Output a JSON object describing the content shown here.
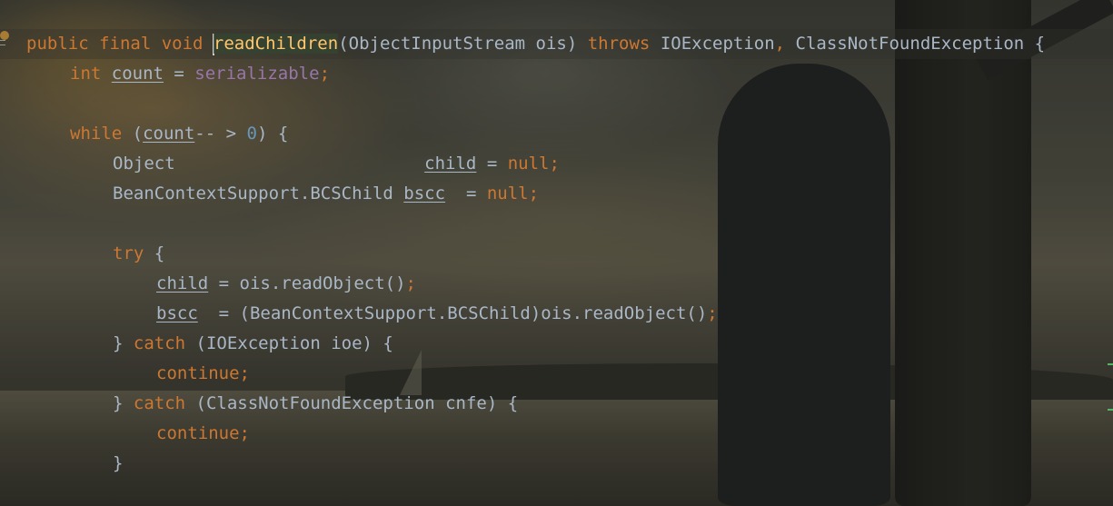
{
  "editor": {
    "colors": {
      "keyword": "#cc7832",
      "method_decl": "#ffc66d",
      "field": "#9876aa",
      "number": "#6897bb",
      "text": "#a9b7c6",
      "gutter_bulb": "#e9a53b"
    },
    "icons": {
      "gutter": "lightbulb-icon"
    },
    "lines": {
      "l1": {
        "kw1": "public final void ",
        "method": "readChildren",
        "args": "(ObjectInputStream ois) ",
        "kw2": "throws ",
        "ex1": "IOException",
        "comma": ", ",
        "ex2": "ClassNotFoundException {"
      },
      "l2": {
        "kw": "int ",
        "var": "count",
        "eq": " = ",
        "field": "serializable",
        "semi": ";"
      },
      "l4": {
        "kw": "while ",
        "open": "(",
        "var": "count",
        "op": "-- > ",
        "num": "0",
        "close": ") {"
      },
      "l5": {
        "type": "Object                        ",
        "var": "child",
        "eq": " = ",
        "kw": "null;"
      },
      "l6": {
        "type": "BeanContextSupport.BCSChild ",
        "var": "bscc",
        "eq": "  = ",
        "kw": "null;"
      },
      "l8": {
        "kw": "try",
        "rest": " {"
      },
      "l9": {
        "var": "child",
        "rest": " = ois.readObject()",
        "semi": ";"
      },
      "l10": {
        "var": "bscc",
        "rest": "  = (BeanContextSupport.BCSChild)ois.readObject()",
        "semi": ";"
      },
      "l11": {
        "pre": "} ",
        "kw": "catch",
        "rest": " (IOException ioe) {"
      },
      "l12": {
        "kw": "continue;"
      },
      "l13": {
        "pre": "} ",
        "kw": "catch",
        "rest": " (ClassNotFoundException cnfe) {"
      },
      "l14": {
        "kw": "continue;"
      },
      "l15": {
        "text": "}"
      }
    }
  }
}
